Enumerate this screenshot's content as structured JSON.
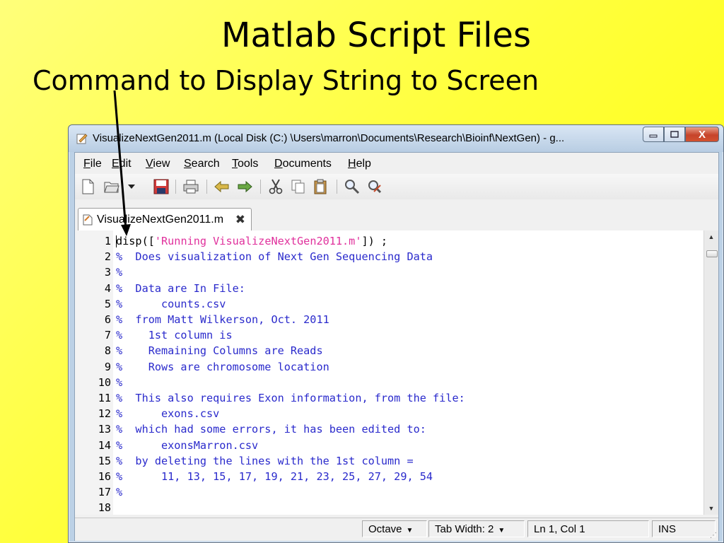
{
  "slide": {
    "title": "Matlab Script Files",
    "subtitle": "Command to Display String to Screen"
  },
  "window": {
    "title": "VisualizeNextGen2011.m (Local Disk (C:) \\Users\\marron\\Documents\\Research\\Bioinf\\NextGen) - g...",
    "buttons": {
      "minimize": "▭",
      "maximize": "□",
      "close": "X"
    }
  },
  "menu": [
    {
      "key": "F",
      "rest": "ile"
    },
    {
      "key": "E",
      "rest": "dit"
    },
    {
      "key": "V",
      "rest": "iew"
    },
    {
      "key": "S",
      "rest": "earch"
    },
    {
      "key": "T",
      "rest": "ools"
    },
    {
      "key": "D",
      "rest": "ocuments"
    },
    {
      "key": "H",
      "rest": "elp"
    }
  ],
  "toolbar_icons": [
    "new-file-icon",
    "open-folder-icon",
    "dropdown-icon",
    "save-icon",
    "print-icon",
    "undo-icon",
    "redo-icon",
    "cut-icon",
    "copy-icon",
    "paste-icon",
    "find-icon",
    "replace-icon"
  ],
  "tab": {
    "label": "VisualizeNextGen2011.m",
    "close": "✖"
  },
  "code_lines": [
    {
      "n": "1",
      "fn": "disp([",
      "str": "'Running VisualizeNextGen2011.m'",
      "after": "]) ;"
    },
    {
      "n": "2",
      "text": "%  Does visualization of Next Gen Sequencing Data"
    },
    {
      "n": "3",
      "text": "%"
    },
    {
      "n": "4",
      "text": "%  Data are In File:"
    },
    {
      "n": "5",
      "text": "%      counts.csv"
    },
    {
      "n": "6",
      "text": "%  from Matt Wilkerson, Oct. 2011"
    },
    {
      "n": "7",
      "text": "%    1st column is"
    },
    {
      "n": "8",
      "text": "%    Remaining Columns are Reads"
    },
    {
      "n": "9",
      "text": "%    Rows are chromosome location"
    },
    {
      "n": "10",
      "text": "%"
    },
    {
      "n": "11",
      "text": "%  This also requires Exon information, from the file:"
    },
    {
      "n": "12",
      "text": "%      exons.csv"
    },
    {
      "n": "13",
      "text": "%  which had some errors, it has been edited to:"
    },
    {
      "n": "14",
      "text": "%      exonsMarron.csv"
    },
    {
      "n": "15",
      "text": "%  by deleting the lines with the 1st column ="
    },
    {
      "n": "16",
      "text": "%      11, 13, 15, 17, 19, 21, 23, 25, 27, 29, 54"
    },
    {
      "n": "17",
      "text": "%"
    },
    {
      "n": "18",
      "text": ""
    }
  ],
  "status": {
    "language": "Octave",
    "tab_width": "Tab Width:  2",
    "position": "Ln 1, Col 1",
    "mode": "INS"
  },
  "colors": {
    "comment": "#2a2acc",
    "string": "#e0309c",
    "background": "#ffff00"
  }
}
